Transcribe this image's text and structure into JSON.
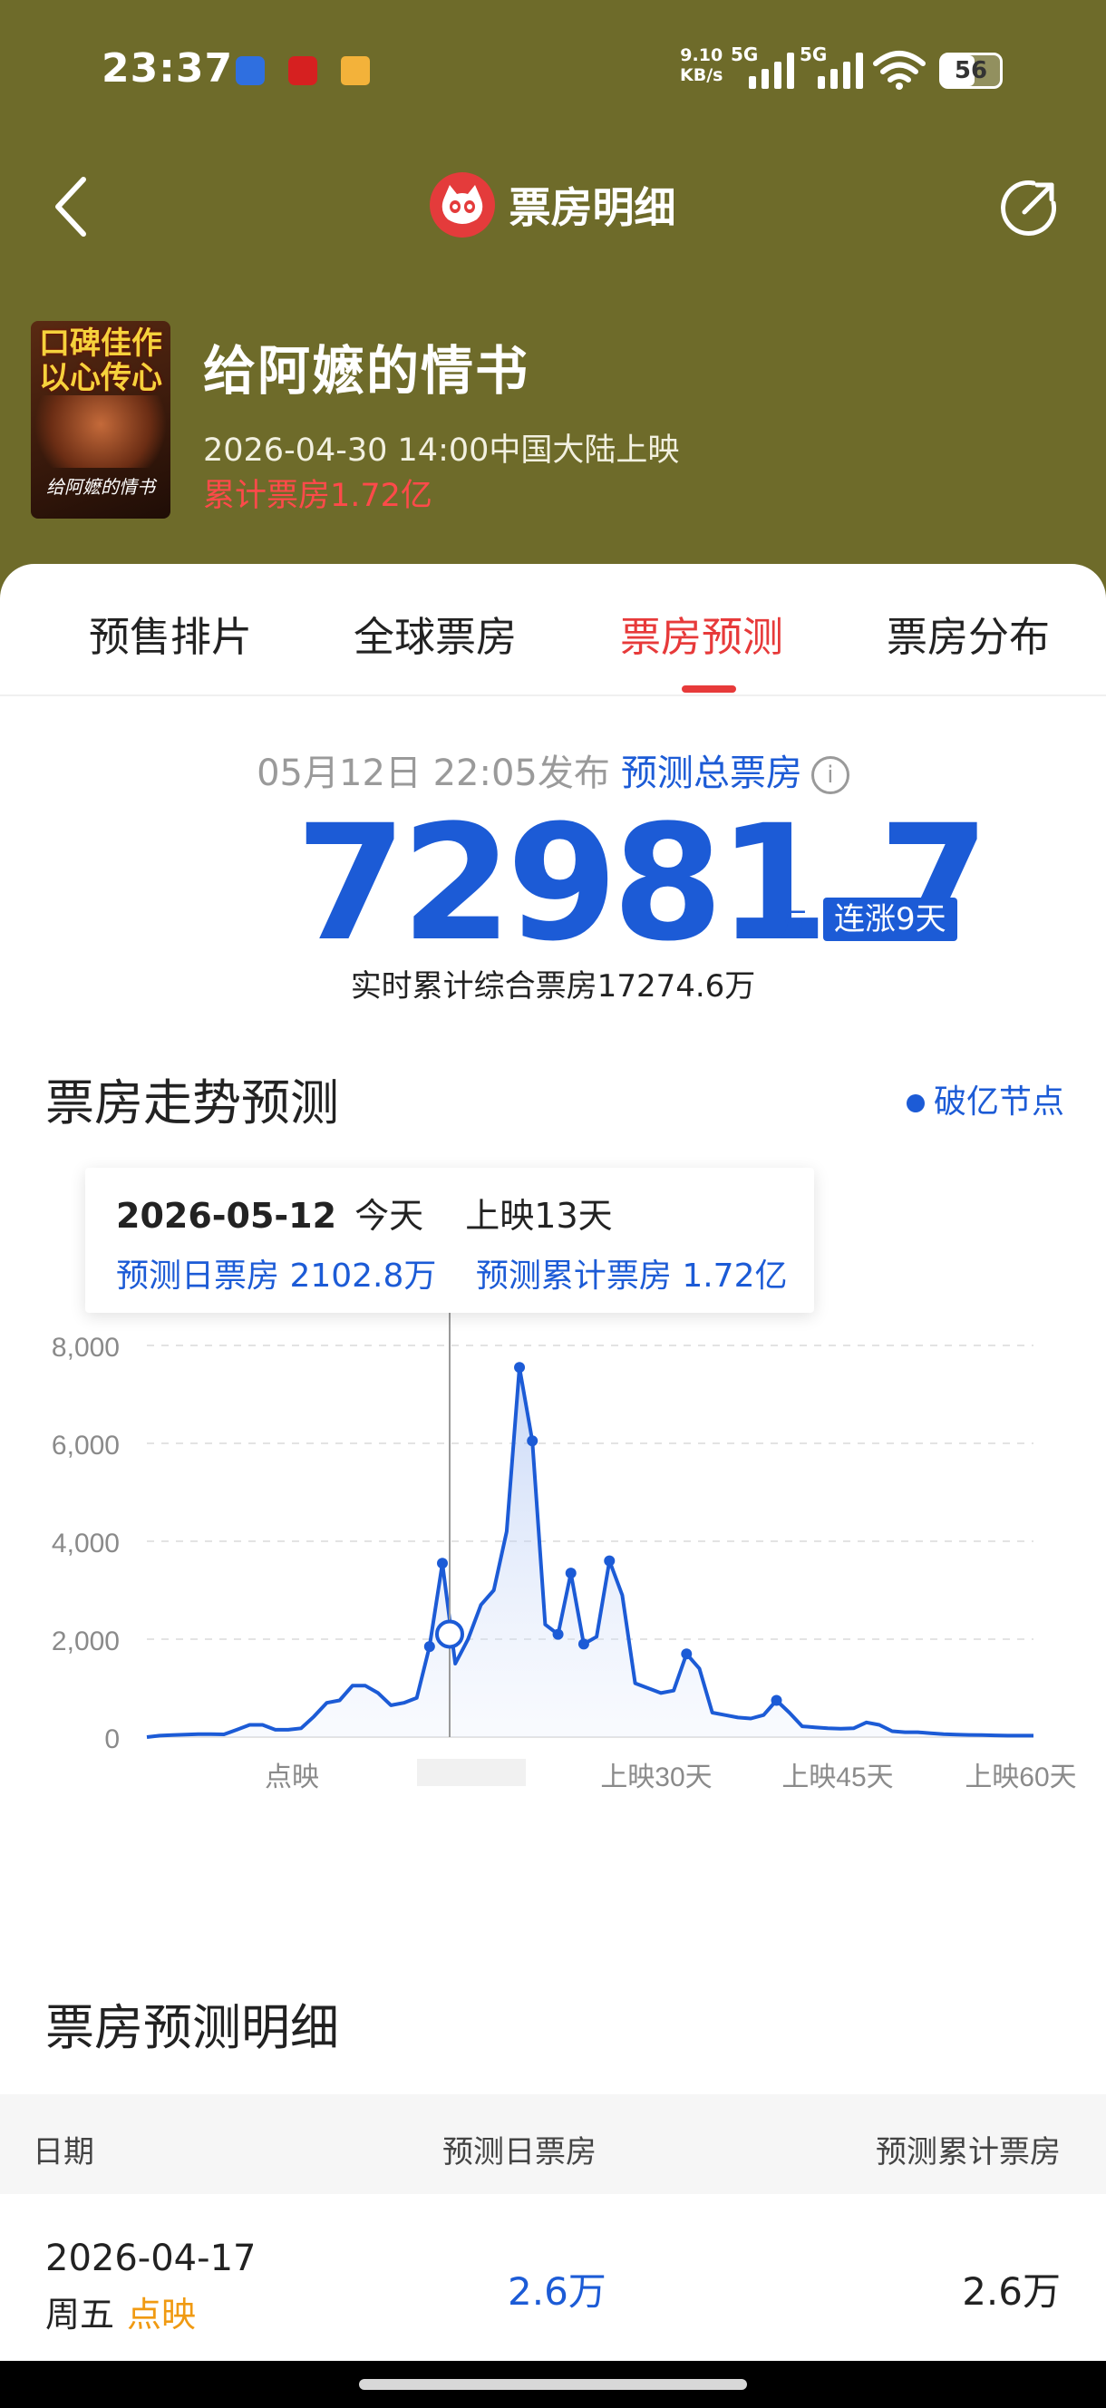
{
  "status_bar": {
    "time": "23:37",
    "speed_top": "9.10",
    "speed_bottom": "KB/s",
    "net1": "5G",
    "net2": "5G",
    "battery": "56"
  },
  "nav": {
    "title": "票房明细",
    "back_icon": "chevron-left-icon",
    "share_icon": "share-icon"
  },
  "movie": {
    "title": "给阿嬷的情书",
    "release": "2026-04-30 14:00中国大陆上映",
    "total": "累计票房1.72亿",
    "poster_slogan": "口碑佳作以心传心",
    "poster_name": "给阿嬷的情书"
  },
  "tabs": [
    {
      "label": "预售排片"
    },
    {
      "label": "全球票房"
    },
    {
      "label": "票房预测"
    },
    {
      "label": "票房分布"
    }
  ],
  "forecast": {
    "published": "05月12日 22:05发布",
    "label": "预测总票房",
    "info_icon": "i",
    "total": "72981.7",
    "unit": "万",
    "badge": "连涨9天",
    "realtime": "实时累计综合票房17274.6万"
  },
  "trend": {
    "title": "票房走势预测",
    "legend": "破亿节点",
    "tooltip_date": "2026-05-12",
    "tooltip_today": "今天",
    "tooltip_days": "上映13天",
    "tooltip_daily": "预测日票房 2102.8万",
    "tooltip_cum": "预测累计票房 1.72亿"
  },
  "chart_data": {
    "type": "area",
    "y_ticks": [
      "8,000",
      "6,000",
      "4,000",
      "2,000",
      "0"
    ],
    "ylim": [
      0,
      8000
    ],
    "x_tick_labels": [
      "点映",
      "",
      "上映30天",
      "上映45天",
      "上映60天"
    ],
    "x_tick_index": [
      13,
      33,
      53,
      73,
      93
    ],
    "selected_index": 33,
    "values": [
      0,
      30,
      40,
      50,
      60,
      60,
      55,
      150,
      250,
      250,
      150,
      150,
      180,
      420,
      700,
      750,
      1050,
      1050,
      900,
      650,
      700,
      800,
      1850,
      3550,
      1500,
      2000,
      2700,
      3000,
      4200,
      7550,
      6050,
      2300,
      2100,
      3350,
      1900,
      2050,
      3600,
      2900,
      1100,
      1000,
      900,
      950,
      1700,
      1400,
      500,
      450,
      400,
      380,
      450,
      750,
      500,
      220,
      200,
      180,
      170,
      180,
      300,
      250,
      120,
      100,
      100,
      80,
      60,
      50,
      45,
      40,
      35,
      30,
      30,
      30
    ]
  },
  "detail": {
    "title": "票房预测明细",
    "headers": [
      "日期",
      "预测日票房",
      "预测累计票房"
    ],
    "rows": [
      {
        "date": "2026-04-17",
        "weekday": "周五",
        "tag": "点映",
        "daily": "2.6万",
        "cumulative": "2.6万"
      }
    ]
  },
  "colors": {
    "header": "#6e6b2a",
    "accent_blue": "#1c5bd6",
    "accent_red": "#e73a3a",
    "tag_orange": "#f09a12"
  }
}
